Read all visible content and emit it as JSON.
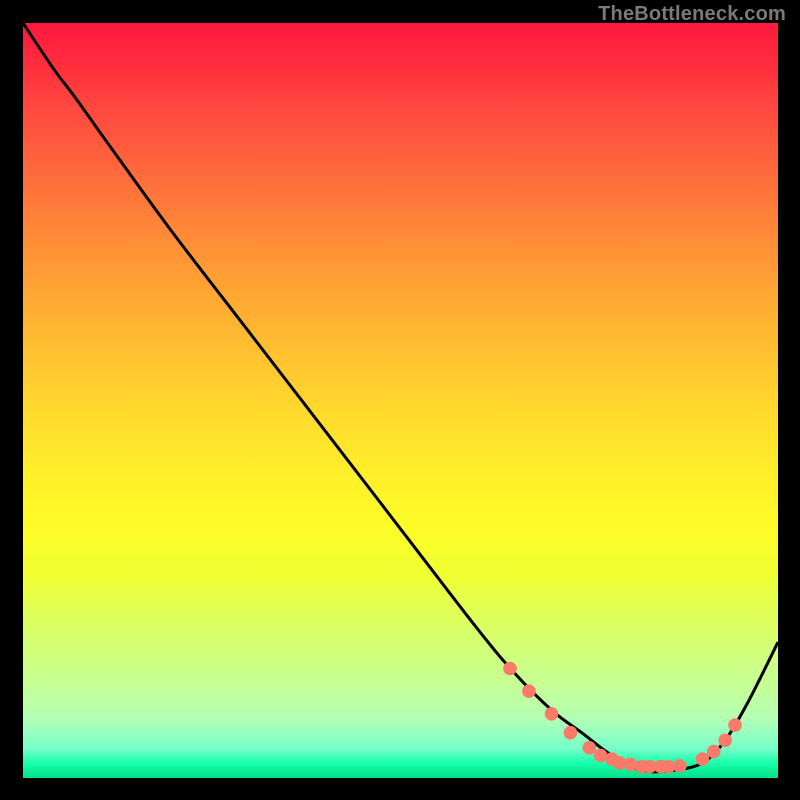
{
  "watermark": "TheBottleneck.com",
  "chart_data": {
    "type": "line",
    "title": "",
    "xlabel": "",
    "ylabel": "",
    "xlim": [
      0,
      100
    ],
    "ylim": [
      0,
      100
    ],
    "grid": false,
    "legend": false,
    "background": "red-yellow-green vertical gradient",
    "series": [
      {
        "name": "curve",
        "color": "#000000",
        "x": [
          0,
          4,
          7,
          12,
          20,
          30,
          40,
          50,
          60,
          65,
          70,
          74,
          78,
          82,
          86,
          90,
          93,
          96,
          100
        ],
        "y": [
          100,
          94,
          90,
          83,
          72,
          59,
          46,
          33,
          20,
          14,
          9,
          6,
          3,
          1,
          1,
          2,
          5,
          10,
          18
        ]
      }
    ],
    "markers": {
      "color": "#fb7a6a",
      "radius_pct": 0.9,
      "points": [
        {
          "x": 64.5,
          "y": 14.5
        },
        {
          "x": 67.0,
          "y": 11.5
        },
        {
          "x": 70.0,
          "y": 8.5
        },
        {
          "x": 72.5,
          "y": 6.0
        },
        {
          "x": 75.0,
          "y": 4.0
        },
        {
          "x": 76.5,
          "y": 3.0
        },
        {
          "x": 78.0,
          "y": 2.5
        },
        {
          "x": 79.0,
          "y": 2.0
        },
        {
          "x": 80.5,
          "y": 1.8
        },
        {
          "x": 82.0,
          "y": 1.5
        },
        {
          "x": 83.0,
          "y": 1.5
        },
        {
          "x": 84.5,
          "y": 1.5
        },
        {
          "x": 85.5,
          "y": 1.5
        },
        {
          "x": 87.0,
          "y": 1.6
        },
        {
          "x": 90.0,
          "y": 2.5
        },
        {
          "x": 91.5,
          "y": 3.5
        },
        {
          "x": 93.0,
          "y": 5.0
        },
        {
          "x": 94.3,
          "y": 7.0
        }
      ]
    }
  }
}
